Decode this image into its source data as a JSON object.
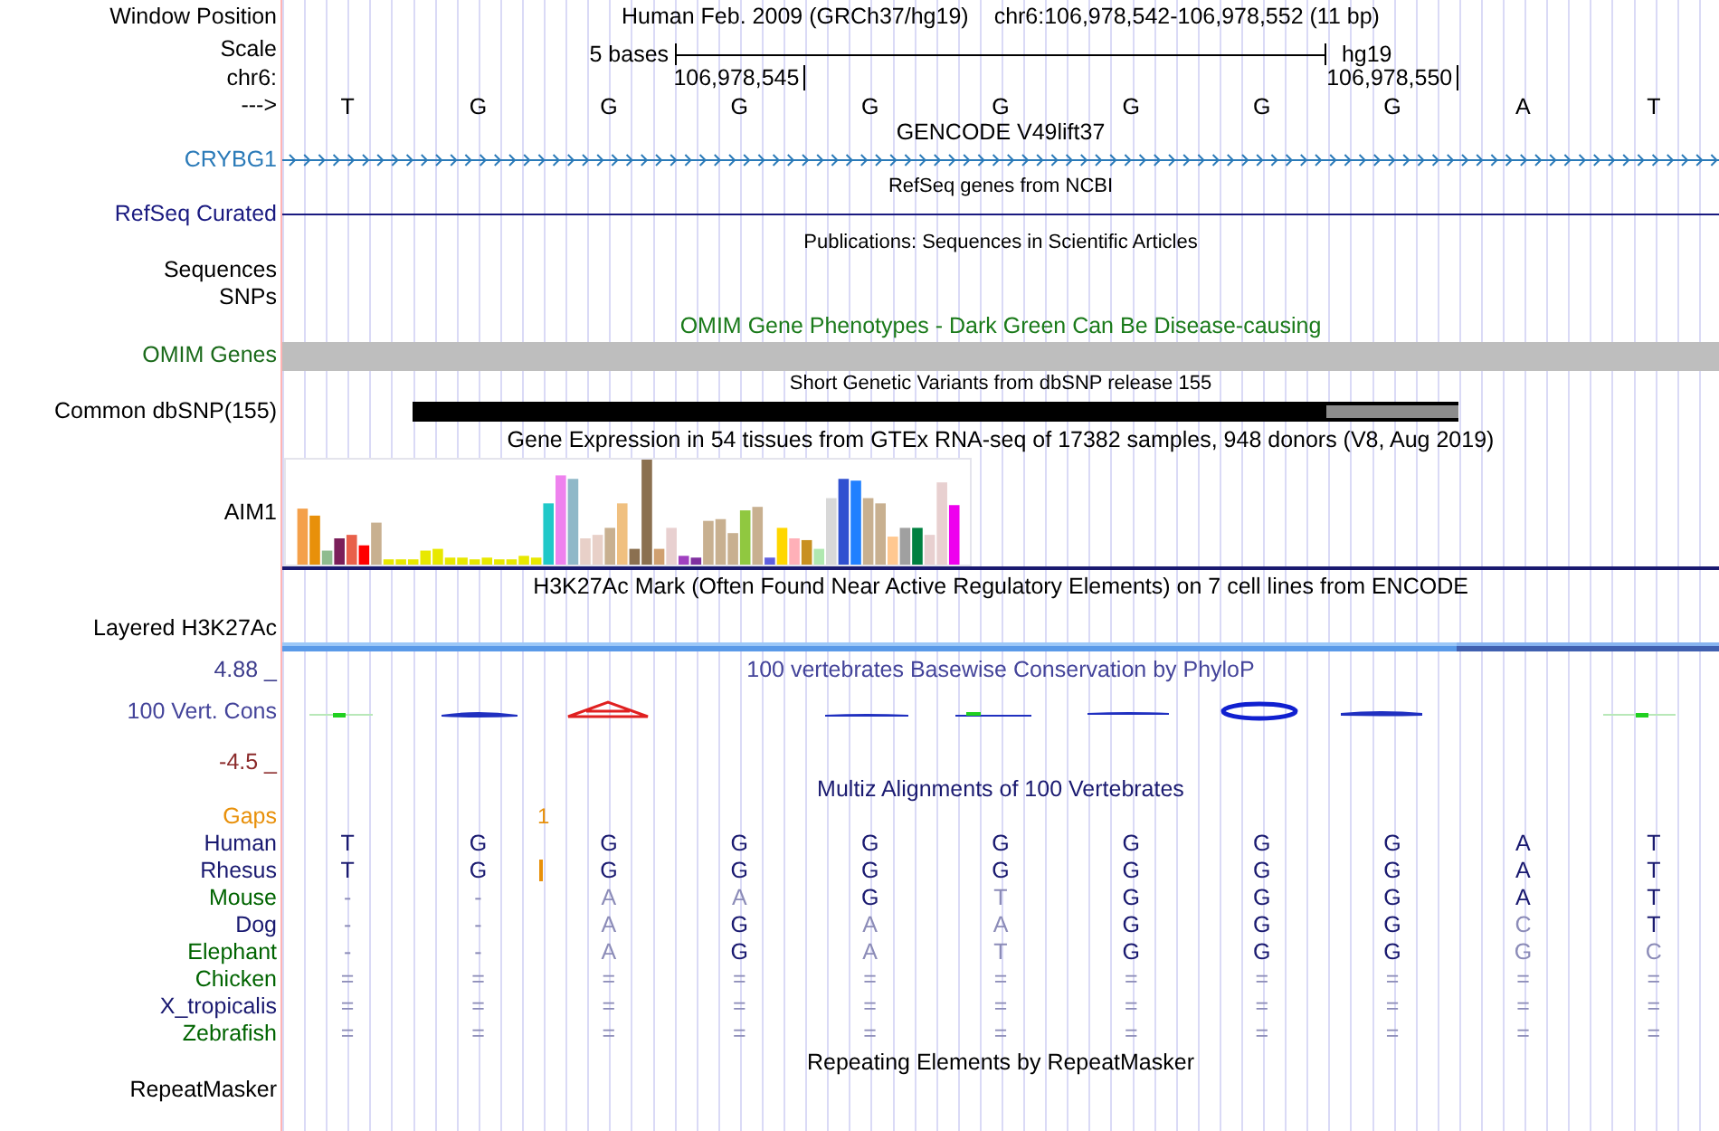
{
  "position": {
    "label": "Window Position",
    "assembly": "Human Feb. 2009 (GRCh37/hg19)",
    "range": "chr6:106,978,542-106,978,552 (11 bp)"
  },
  "scale": {
    "label": "Scale",
    "bar_text": "5 bases",
    "assembly_tag": "hg19"
  },
  "coordinates": {
    "label": "chr6:",
    "ticks": [
      "106,978,545",
      "106,978,550"
    ]
  },
  "strand": {
    "label": "--->",
    "bases": [
      "T",
      "G",
      "G",
      "G",
      "G",
      "G",
      "G",
      "G",
      "G",
      "A",
      "T"
    ]
  },
  "tracks": [
    {
      "kind": "gene",
      "title": "GENCODE V49lift37",
      "label": "CRYBG1"
    },
    {
      "kind": "line",
      "title": "RefSeq genes from NCBI",
      "label": "RefSeq Curated"
    },
    {
      "kind": "empty",
      "title": "Publications: Sequences in Scientific Articles",
      "label": "Sequences"
    },
    {
      "kind": "empty",
      "label": "SNPs"
    },
    {
      "kind": "bar",
      "title": "OMIM Gene Phenotypes - Dark Green Can Be Disease-causing",
      "label": "OMIM Genes"
    },
    {
      "kind": "variant",
      "title": "Short Genetic Variants from dbSNP release 155",
      "label": "Common dbSNP(155)"
    },
    {
      "kind": "expression",
      "title": "Gene Expression in 54 tissues from GTEx RNA-seq of 17382 samples, 948 donors (V8, Aug 2019)",
      "label": "AIM1"
    },
    {
      "kind": "signal",
      "title": "H3K27Ac Mark (Often Found Near Active Regulatory Elements) on 7 cell lines from ENCODE",
      "label": "Layered H3K27Ac"
    },
    {
      "kind": "conservation",
      "title": "100 vertebrates Basewise Conservation by PhyloP",
      "label": "100 Vert. Cons",
      "y_max": "4.88 _",
      "y_min": "-4.5 _"
    }
  ],
  "alignment": {
    "title": "Multiz Alignments of 100 Vertebrates",
    "gaps": {
      "label": "Gaps",
      "count": "1"
    },
    "species": [
      {
        "name": "Human",
        "color": "#191970",
        "bases": [
          {
            "base": "T",
            "conserved": true
          },
          {
            "base": "G",
            "conserved": true
          },
          {
            "base": "G",
            "conserved": true
          },
          {
            "base": "G",
            "conserved": true
          },
          {
            "base": "G",
            "conserved": true
          },
          {
            "base": "G",
            "conserved": true
          },
          {
            "base": "G",
            "conserved": true
          },
          {
            "base": "G",
            "conserved": true
          },
          {
            "base": "G",
            "conserved": true
          },
          {
            "base": "A",
            "conserved": true
          },
          {
            "base": "T",
            "conserved": true
          }
        ]
      },
      {
        "name": "Rhesus",
        "color": "#191970",
        "bases": [
          {
            "base": "T",
            "conserved": true
          },
          {
            "base": "G",
            "conserved": true,
            "insertion": true
          },
          {
            "base": "G",
            "conserved": true
          },
          {
            "base": "G",
            "conserved": true
          },
          {
            "base": "G",
            "conserved": true
          },
          {
            "base": "G",
            "conserved": true
          },
          {
            "base": "G",
            "conserved": true
          },
          {
            "base": "G",
            "conserved": true
          },
          {
            "base": "G",
            "conserved": true
          },
          {
            "base": "A",
            "conserved": true
          },
          {
            "base": "T",
            "conserved": true
          }
        ]
      },
      {
        "name": "Mouse",
        "color": "#006400",
        "bases": [
          {
            "base": "-",
            "conserved": false
          },
          {
            "base": "-",
            "conserved": false
          },
          {
            "base": "A",
            "conserved": false
          },
          {
            "base": "A",
            "conserved": false
          },
          {
            "base": "G",
            "conserved": true
          },
          {
            "base": "T",
            "conserved": false
          },
          {
            "base": "G",
            "conserved": true
          },
          {
            "base": "G",
            "conserved": true
          },
          {
            "base": "G",
            "conserved": true
          },
          {
            "base": "A",
            "conserved": true
          },
          {
            "base": "T",
            "conserved": true
          }
        ]
      },
      {
        "name": "Dog",
        "color": "#191970",
        "bases": [
          {
            "base": "-",
            "conserved": false
          },
          {
            "base": "-",
            "conserved": false
          },
          {
            "base": "A",
            "conserved": false
          },
          {
            "base": "G",
            "conserved": true
          },
          {
            "base": "A",
            "conserved": false
          },
          {
            "base": "A",
            "conserved": false
          },
          {
            "base": "G",
            "conserved": true
          },
          {
            "base": "G",
            "conserved": true
          },
          {
            "base": "G",
            "conserved": true
          },
          {
            "base": "C",
            "conserved": false
          },
          {
            "base": "T",
            "conserved": true
          }
        ]
      },
      {
        "name": "Elephant",
        "color": "#006400",
        "bases": [
          {
            "base": "-",
            "conserved": false
          },
          {
            "base": "-",
            "conserved": false
          },
          {
            "base": "A",
            "conserved": false
          },
          {
            "base": "G",
            "conserved": true
          },
          {
            "base": "A",
            "conserved": false
          },
          {
            "base": "T",
            "conserved": false
          },
          {
            "base": "G",
            "conserved": true
          },
          {
            "base": "G",
            "conserved": true
          },
          {
            "base": "G",
            "conserved": true
          },
          {
            "base": "G",
            "conserved": false
          },
          {
            "base": "C",
            "conserved": false
          }
        ]
      },
      {
        "name": "Chicken",
        "color": "#006400",
        "bases": [
          {
            "base": "=",
            "conserved": false
          },
          {
            "base": "=",
            "conserved": false
          },
          {
            "base": "=",
            "conserved": false
          },
          {
            "base": "=",
            "conserved": false
          },
          {
            "base": "=",
            "conserved": false
          },
          {
            "base": "=",
            "conserved": false
          },
          {
            "base": "=",
            "conserved": false
          },
          {
            "base": "=",
            "conserved": false
          },
          {
            "base": "=",
            "conserved": false
          },
          {
            "base": "=",
            "conserved": false
          },
          {
            "base": "=",
            "conserved": false
          }
        ]
      },
      {
        "name": "X_tropicalis",
        "color": "#191970",
        "bases": [
          {
            "base": "=",
            "conserved": false
          },
          {
            "base": "=",
            "conserved": false
          },
          {
            "base": "=",
            "conserved": false
          },
          {
            "base": "=",
            "conserved": false
          },
          {
            "base": "=",
            "conserved": false
          },
          {
            "base": "=",
            "conserved": false
          },
          {
            "base": "=",
            "conserved": false
          },
          {
            "base": "=",
            "conserved": false
          },
          {
            "base": "=",
            "conserved": false
          },
          {
            "base": "=",
            "conserved": false
          },
          {
            "base": "=",
            "conserved": false
          }
        ]
      },
      {
        "name": "Zebrafish",
        "color": "#006400",
        "bases": [
          {
            "base": "=",
            "conserved": false
          },
          {
            "base": "=",
            "conserved": false
          },
          {
            "base": "=",
            "conserved": false
          },
          {
            "base": "=",
            "conserved": false
          },
          {
            "base": "=",
            "conserved": false
          },
          {
            "base": "=",
            "conserved": false
          },
          {
            "base": "=",
            "conserved": false
          },
          {
            "base": "=",
            "conserved": false
          },
          {
            "base": "=",
            "conserved": false
          },
          {
            "base": "=",
            "conserved": false
          },
          {
            "base": "=",
            "conserved": false
          }
        ]
      }
    ]
  },
  "repeats": {
    "title": "Repeating Elements by RepeatMasker",
    "label": "RepeatMasker"
  }
}
